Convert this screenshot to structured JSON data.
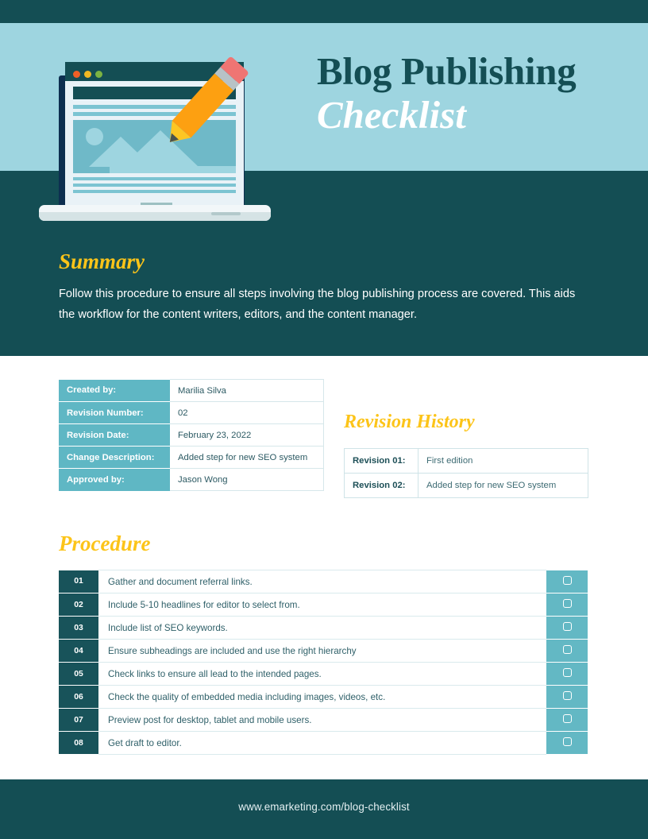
{
  "header": {
    "title_line1": "Blog Publishing",
    "title_line2": "Checklist",
    "illustration": {
      "dot_colors": [
        "#ee5f26",
        "#f0b823",
        "#7cb342"
      ],
      "pencil_color": "#fda011",
      "eraser_color": "#ef7573"
    }
  },
  "summary": {
    "heading": "Summary",
    "body": "Follow this procedure to ensure all steps involving the blog publishing process are covered. This aids the workflow for the content writers, editors, and the content manager."
  },
  "info": {
    "rows": [
      {
        "label": "Created by:",
        "value": "Marilia Silva"
      },
      {
        "label": "Revision Number:",
        "value": "02"
      },
      {
        "label": "Revision Date:",
        "value": "February 23, 2022"
      },
      {
        "label": "Change Description:",
        "value": "Added step for new SEO system"
      },
      {
        "label": "Approved by:",
        "value": "Jason Wong"
      }
    ]
  },
  "revision_history": {
    "heading": "Revision History",
    "rows": [
      {
        "label": "Revision 01:",
        "value": "First edition"
      },
      {
        "label": "Revision 02:",
        "value": "Added step for new SEO system"
      }
    ]
  },
  "procedure": {
    "heading": "Procedure",
    "steps": [
      {
        "num": "01",
        "text": "Gather and document referral links."
      },
      {
        "num": "02",
        "text": "Include 5-10 headlines for editor to select from."
      },
      {
        "num": "03",
        "text": "Include list of SEO keywords."
      },
      {
        "num": "04",
        "text": "Ensure subheadings are included and use the right hierarchy"
      },
      {
        "num": "05",
        "text": "Check links to ensure all lead to the intended pages."
      },
      {
        "num": "06",
        "text": "Check the quality of embedded media including images, videos, etc."
      },
      {
        "num": "07",
        "text": "Preview post for desktop, tablet and mobile users."
      },
      {
        "num": "08",
        "text": "Get draft to editor."
      }
    ]
  },
  "footer": {
    "url": "www.emarketing.com/blog-checklist"
  },
  "colors": {
    "dark_teal": "#144e54",
    "light_blue": "#9ed5e0",
    "accent_yellow": "#fcc419",
    "medium_teal": "#5fb7c4",
    "step_teal": "#18535a",
    "checkbox_teal": "#63b8c4"
  }
}
